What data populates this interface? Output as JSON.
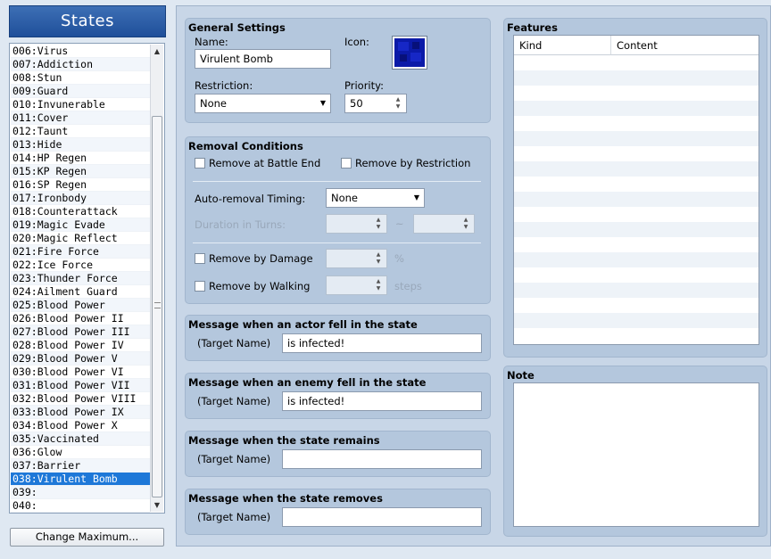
{
  "states_header": "States",
  "state_list": [
    "006:Virus",
    "007:Addiction",
    "008:Stun",
    "009:Guard",
    "010:Invunerable",
    "011:Cover",
    "012:Taunt",
    "013:Hide",
    "014:HP Regen",
    "015:KP Regen",
    "016:SP Regen",
    "017:Ironbody",
    "018:Counterattack",
    "019:Magic Evade",
    "020:Magic Reflect",
    "021:Fire Force",
    "022:Ice Force",
    "023:Thunder Force",
    "024:Ailment Guard",
    "025:Blood Power",
    "026:Blood Power II",
    "027:Blood Power III",
    "028:Blood Power IV",
    "029:Blood Power V",
    "030:Blood Power VI",
    "031:Blood Power VII",
    "032:Blood Power VIII",
    "033:Blood Power IX",
    "034:Blood Power X",
    "035:Vaccinated",
    "036:Glow",
    "037:Barrier",
    "038:Virulent Bomb",
    "039:",
    "040:"
  ],
  "selected_index": 32,
  "change_max_label": "Change Maximum...",
  "general": {
    "title": "General Settings",
    "name_label": "Name:",
    "name_value": "Virulent Bomb",
    "icon_label": "Icon:",
    "restriction_label": "Restriction:",
    "restriction_value": "None",
    "priority_label": "Priority:",
    "priority_value": "50"
  },
  "removal": {
    "title": "Removal Conditions",
    "battle_end": "Remove at Battle End",
    "by_restriction": "Remove by Restriction",
    "auto_timing_label": "Auto-removal Timing:",
    "auto_timing_value": "None",
    "duration_label": "Duration in Turns:",
    "tilde": "~",
    "by_damage": "Remove by Damage",
    "percent": "%",
    "by_walking": "Remove by Walking",
    "steps": "steps"
  },
  "messages": [
    {
      "title": "Message when an actor fell in the state",
      "target": "(Target Name)",
      "value": " is infected!"
    },
    {
      "title": "Message when an enemy fell in the state",
      "target": "(Target Name)",
      "value": " is infected!"
    },
    {
      "title": "Message when the state remains",
      "target": "(Target Name)",
      "value": ""
    },
    {
      "title": "Message when the state removes",
      "target": "(Target Name)",
      "value": ""
    }
  ],
  "features": {
    "title": "Features",
    "col_kind": "Kind",
    "col_content": "Content"
  },
  "note": {
    "title": "Note"
  },
  "colors": {
    "selected": "#1e78d8",
    "panel": "#b4c7dd",
    "header": "#2a5ca8"
  },
  "icons": {
    "spin_up": "▲",
    "spin_down": "▼",
    "dropdown": "▼",
    "scroll_up": "▲",
    "scroll_down": "▼"
  }
}
